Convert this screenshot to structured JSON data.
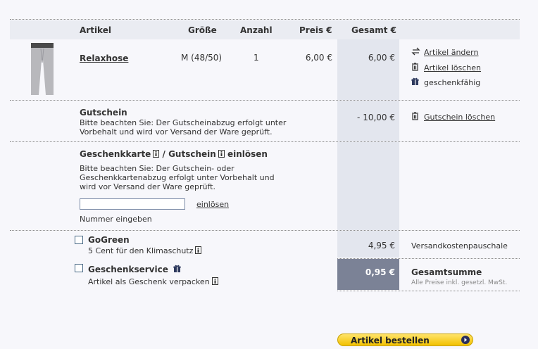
{
  "header": {
    "artikel": "Artikel",
    "groesse": "Größe",
    "anzahl": "Anzahl",
    "preis": "Preis €",
    "gesamt": "Gesamt €"
  },
  "item": {
    "name": "Relaxhose",
    "size": "M (48/50)",
    "quantity": "1",
    "price": "6,00 €",
    "total": "6,00 €",
    "actions": {
      "change": "Artikel ändern",
      "delete": "Artikel löschen",
      "gift": "geschenkfähig"
    }
  },
  "voucher": {
    "title": "Gutschein",
    "note": "Bitte beachten Sie: Der Gutscheinabzug erfolgt unter Vorbehalt und wird vor Versand der Ware geprüft.",
    "amount": "- 10,00 €",
    "delete": "Gutschein löschen"
  },
  "redeem": {
    "title_part1": "Geschenkkarte",
    "title_sep": "/ Gutschein",
    "title_part2": "einlösen",
    "note": "Bitte beachten Sie: Der Gutschein- oder Geschenkkartenabzug erfolgt unter Vorbehalt und wird vor Versand der Ware geprüft.",
    "input_value": "",
    "button": "einlösen",
    "input_label": "Nummer eingeben"
  },
  "gogreen": {
    "title": "GoGreen",
    "subtitle": "5 Cent für den Klimaschutz",
    "checked": false
  },
  "giftservice": {
    "title": "Geschenkservice",
    "subtitle": "Artikel als Geschenk verpacken",
    "checked": false
  },
  "summary": {
    "shipping_value": "4,95 €",
    "shipping_label": "Versandkostenpauschale",
    "total_value": "0,95 €",
    "total_label": "Gesamtsumme",
    "vat_note": "Alle Preise inkl. gesetzl. MwSt."
  },
  "order_button": "Artikel bestellen",
  "colors": {
    "total_box": "#7b8296",
    "column_bg": "#e3e6ee",
    "button": "#f2c100"
  }
}
